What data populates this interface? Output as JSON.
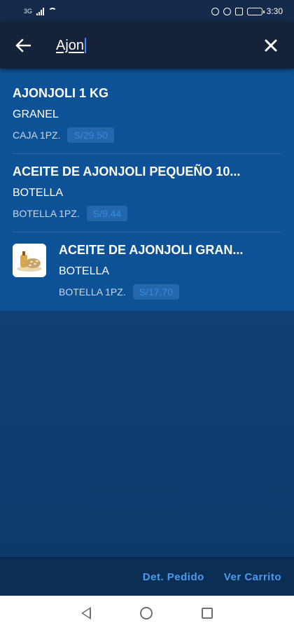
{
  "status_bar": {
    "left_label": "3G",
    "time": "3:30"
  },
  "search": {
    "query": "Ajon"
  },
  "results": [
    {
      "title": "AJONJOLI 1 KG",
      "type": "GRANEL",
      "unit": "CAJA 1PZ.",
      "price": "S/29.50",
      "has_image": false
    },
    {
      "title": "ACEITE DE AJONJOLI PEQUEÑO 10...",
      "type": "BOTELLA",
      "unit": "BOTELLA 1PZ.",
      "price": "S/9.44",
      "has_image": false
    },
    {
      "title": "ACEITE DE AJONJOLI  GRAN...",
      "type": "BOTELLA",
      "unit": "BOTELLA 1PZ.",
      "price": "S/17.70",
      "has_image": true,
      "image_icon": "sesame-product-icon"
    }
  ],
  "bottom_bar": {
    "order_detail_label": "Det. Pedido",
    "view_cart_label": "Ver Carrito"
  },
  "colors": {
    "results_bg": "#0d5296",
    "page_bg": "#0e3a6b",
    "toolbar_bg": "#162238",
    "accent": "#4a9bf0",
    "price_badge_bg": "#2367ad",
    "price_text": "#3b8ae0"
  }
}
